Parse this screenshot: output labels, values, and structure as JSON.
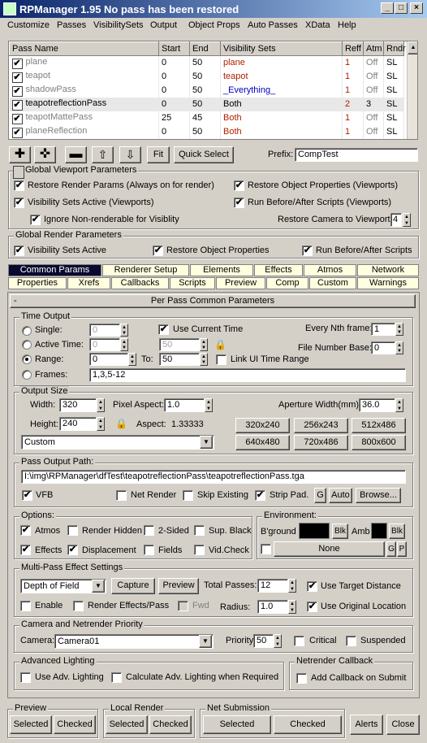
{
  "window": {
    "title": "RPManager 1.95   No pass has been restored"
  },
  "menu": [
    "Customize",
    "Passes",
    "VisibilitySets",
    "Output",
    "Object Props",
    "Auto Passes",
    "XData",
    "Help"
  ],
  "passes": {
    "headers": [
      "Pass Name",
      "Start",
      "End",
      "Visibility Sets",
      "Reff",
      "Atm",
      "Rndr"
    ],
    "rows": [
      {
        "name": "plane",
        "start": "0",
        "end": "50",
        "vis": "plane",
        "reff": "1",
        "atm": "Off",
        "rndr": "SL",
        "style": "gray",
        "vis_color": "red"
      },
      {
        "name": "teapot",
        "start": "0",
        "end": "50",
        "vis": "teapot",
        "reff": "1",
        "atm": "Off",
        "rndr": "SL",
        "style": "gray",
        "vis_color": "red"
      },
      {
        "name": "shadowPass",
        "start": "0",
        "end": "50",
        "vis": "_Everything_",
        "reff": "1",
        "atm": "Off",
        "rndr": "SL",
        "style": "gray",
        "vis_color": "blue"
      },
      {
        "name": "teapotreflectionPass",
        "start": "0",
        "end": "50",
        "vis": "Both",
        "reff": "2",
        "atm": "3",
        "rndr": "SL",
        "style": "black",
        "vis_color": "black"
      },
      {
        "name": "teapotMattePass",
        "start": "25",
        "end": "45",
        "vis": "Both",
        "reff": "1",
        "atm": "Off",
        "rndr": "SL",
        "style": "gray",
        "vis_color": "red"
      },
      {
        "name": "planeReflection",
        "start": "0",
        "end": "50",
        "vis": "Both",
        "reff": "1",
        "atm": "Off",
        "rndr": "SL",
        "style": "gray",
        "vis_color": "red"
      }
    ]
  },
  "toolbar": {
    "add_icon": "plus-icon",
    "add_multi_icon": "plus-multi-icon",
    "remove_icon": "minus-icon",
    "up_icon": "arrow-up-icon",
    "down_icon": "arrow-down-icon",
    "fit": "Fit",
    "quick_select": "Quick Select",
    "prefix_label": "Prefix:",
    "prefix_value": "CompTest"
  },
  "viewport": {
    "title": "Global Viewport Parameters",
    "restore_render": "Restore Render Params (Always on for render)",
    "restore_obj": "Restore Object Properties (Viewports)",
    "vis_sets": "Visibility Sets Active (Viewports)",
    "run_scripts": "Run Before/After Scripts (Viewports)",
    "ignore": "Ignore Non-renderable for Visiblity",
    "restore_cam": "Restore Camera to Viewport:",
    "restore_cam_val": "4"
  },
  "render": {
    "title": "Global Render Parameters",
    "vis": "Visibility Sets Active",
    "obj": "Restore Object Properties",
    "scripts": "Run Before/After Scripts"
  },
  "tabs_row1": [
    "Common Params",
    "Renderer Setup",
    "Elements",
    "Effects",
    "Atmos",
    "Network"
  ],
  "tabs_row2": [
    "Properties",
    "Xrefs",
    "Callbacks",
    "Scripts",
    "Preview",
    "Comp",
    "Custom",
    "Warnings"
  ],
  "rollout": {
    "toggle": "-",
    "title": "Per Pass Common Parameters"
  },
  "time": {
    "title": "Time Output",
    "single": "Single:",
    "single_val": "0",
    "use_current": "Use Current Time",
    "every_nth": "Every Nth frame:",
    "every_nth_val": "1",
    "active": "Active Time:",
    "active_from": "0",
    "active_to": "50",
    "file_base": "File Number Base:",
    "file_base_val": "0",
    "range": "Range:",
    "range_from": "0",
    "to": "To:",
    "range_to": "50",
    "link": "Link UI Time Range",
    "frames": "Frames:",
    "frames_val": "1,3,5-12"
  },
  "size": {
    "title": "Output Size",
    "width": "Width:",
    "width_val": "320",
    "pixel_aspect": "Pixel Aspect:",
    "pixel_aspect_val": "1.0",
    "aperture": "Aperture Width(mm):",
    "aperture_val": "36.0",
    "height": "Height:",
    "height_val": "240",
    "aspect": "Aspect:",
    "aspect_val": "1.33333",
    "preset": "Custom",
    "presets": [
      "320x240",
      "256x243",
      "512x486",
      "640x480",
      "720x486",
      "800x600"
    ]
  },
  "path": {
    "title": "Pass Output Path:",
    "value": "I:\\img\\RPManager\\dfTest\\teapotreflectionPass\\teapotreflectionPass.tga",
    "vfb": "VFB",
    "net": "Net Render",
    "skip": "Skip Existing",
    "strip": "Strip Pad.",
    "g": "G",
    "auto": "Auto",
    "browse": "Browse..."
  },
  "options": {
    "title": "Options:",
    "atmos": "Atmos",
    "hidden": "Render Hidden",
    "twosided": "2-Sided",
    "supblack": "Sup. Black",
    "effects": "Effects",
    "displacement": "Displacement",
    "fields": "Fields",
    "vidcheck": "Vid.Check"
  },
  "env": {
    "title": "Environment:",
    "bground": "B'ground",
    "blk1": "Blk",
    "amb": "Amb",
    "blk2": "Blk",
    "none": "None",
    "g": "G",
    "p": "P"
  },
  "multipass": {
    "title": "Multi-Pass Effect Settings",
    "effect": "Depth of Field",
    "capture": "Capture",
    "preview": "Preview",
    "total": "Total Passes:",
    "total_val": "12",
    "target": "Use Target Distance",
    "enable": "Enable",
    "render_effects": "Render Effects/Pass",
    "fwd": "Fwd",
    "radius": "Radius:",
    "radius_val": "1.0",
    "orig_loc": "Use Original Location"
  },
  "camera": {
    "title": "Camera and Netrender Priority",
    "label": "Camera:",
    "value": "Camera01",
    "priority": "Priority",
    "priority_val": "50",
    "critical": "Critical",
    "suspended": "Suspended"
  },
  "adv": {
    "title": "Advanced Lighting",
    "use": "Use Adv. Lighting",
    "calc": "Calculate Adv. Lighting when Required"
  },
  "callback": {
    "title": "Netrender Callback",
    "add": "Add Callback on Submit"
  },
  "bottom": {
    "preview": "Preview",
    "local": "Local Render",
    "net": "Net Submission",
    "selected": "Selected",
    "checked": "Checked",
    "alerts": "Alerts",
    "close": "Close"
  }
}
